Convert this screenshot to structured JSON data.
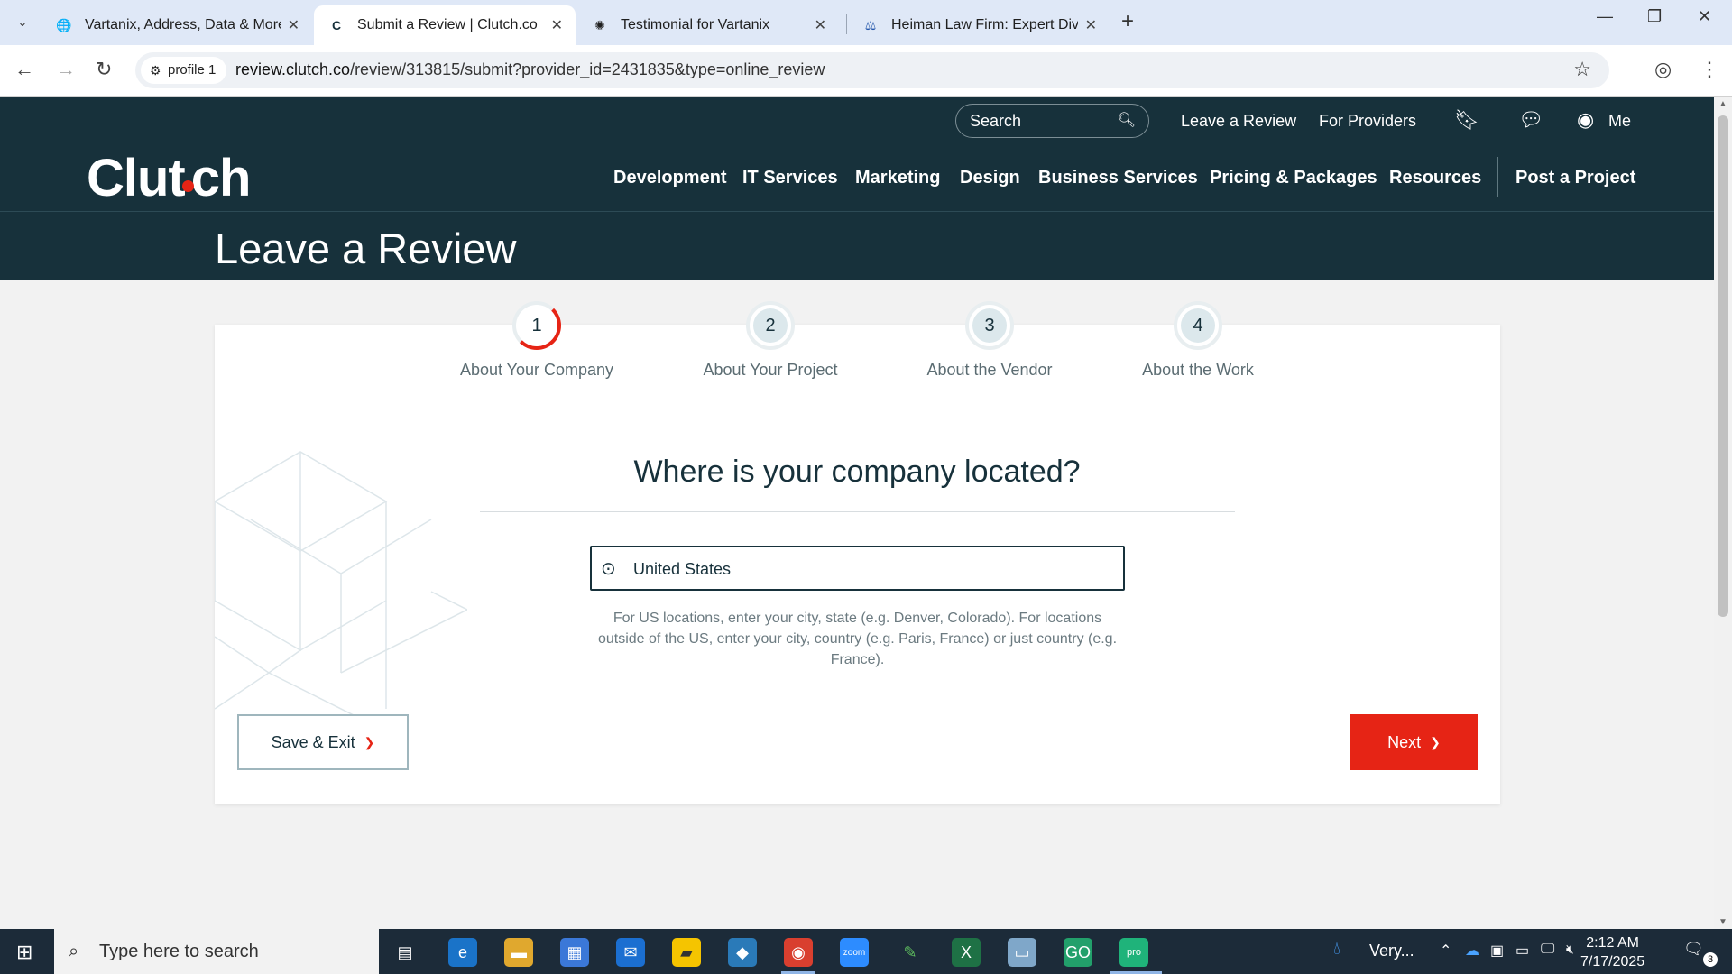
{
  "browser": {
    "tabs": [
      {
        "title": "Vartanix, Address, Data & More",
        "icon": "globe-icon"
      },
      {
        "title": "Submit a Review | Clutch.co",
        "icon": "clutch-icon",
        "active": true
      },
      {
        "title": "Testimonial for Vartanix",
        "icon": "chatgpt-icon"
      },
      {
        "title": "Heiman Law Firm: Expert Divorc",
        "icon": "scales-icon"
      }
    ],
    "profile_chip": "profile 1",
    "url_host": "review.clutch.co",
    "url_path": "/review/313815/submit?provider_id=2431835&type=online_review"
  },
  "site": {
    "logo": "Clutch",
    "search_placeholder": "Search",
    "top_links": {
      "leave_review": "Leave a Review",
      "providers": "For Providers",
      "me": "Me"
    },
    "nav": [
      "Development",
      "IT Services",
      "Marketing",
      "Design",
      "Business Services",
      "Pricing & Packages",
      "Resources"
    ],
    "post_project": "Post a Project",
    "page_title": "Leave a Review"
  },
  "steps": [
    {
      "num": "1",
      "label": "About Your Company",
      "current": true
    },
    {
      "num": "2",
      "label": "About Your Project"
    },
    {
      "num": "3",
      "label": "About the Vendor"
    },
    {
      "num": "4",
      "label": "About the Work"
    }
  ],
  "form": {
    "question": "Where is your company located?",
    "location_value": "United States",
    "hint": "For US locations, enter your city, state (e.g. Denver, Colorado). For locations outside of the US, enter your city, country (e.g. Paris, France) or just country (e.g. France).",
    "save_label": "Save & Exit",
    "next_label": "Next"
  },
  "taskbar": {
    "search_placeholder": "Type here to search",
    "weather": "Very...",
    "time": "2:12 AM",
    "date": "7/17/2025",
    "notification_count": "3"
  },
  "colors": {
    "brand_dark": "#17313b",
    "accent_red": "#e62415"
  }
}
